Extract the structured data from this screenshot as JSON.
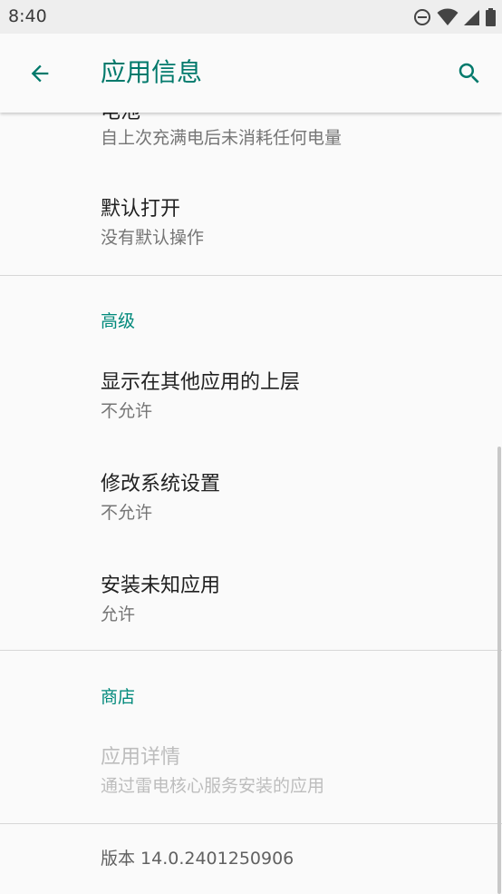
{
  "status_bar": {
    "time": "8:40"
  },
  "app_bar": {
    "title": "应用信息"
  },
  "prefs": {
    "battery": {
      "title": "电池",
      "summary": "自上次充满电后未消耗任何电量"
    },
    "open_by_default": {
      "title": "默认打开",
      "summary": "没有默认操作"
    },
    "advanced_header": "高级",
    "display_over_apps": {
      "title": "显示在其他应用的上层",
      "summary": "不允许"
    },
    "modify_system_settings": {
      "title": "修改系统设置",
      "summary": "不允许"
    },
    "install_unknown_apps": {
      "title": "安装未知应用",
      "summary": "允许"
    },
    "store_header": "商店",
    "app_details": {
      "title": "应用详情",
      "summary": "通过雷电核心服务安装的应用"
    },
    "version": "版本 14.0.2401250906"
  },
  "colors": {
    "accent": "#00796b",
    "category": "#00897b",
    "status_bar_bg": "#eeeeee",
    "background": "#fafafa"
  },
  "icons": {
    "back": "arrow-back-icon",
    "search": "search-icon",
    "dnd": "do-not-disturb-icon",
    "wifi": "wifi-icon",
    "signal": "cell-signal-icon",
    "battery": "battery-icon"
  }
}
